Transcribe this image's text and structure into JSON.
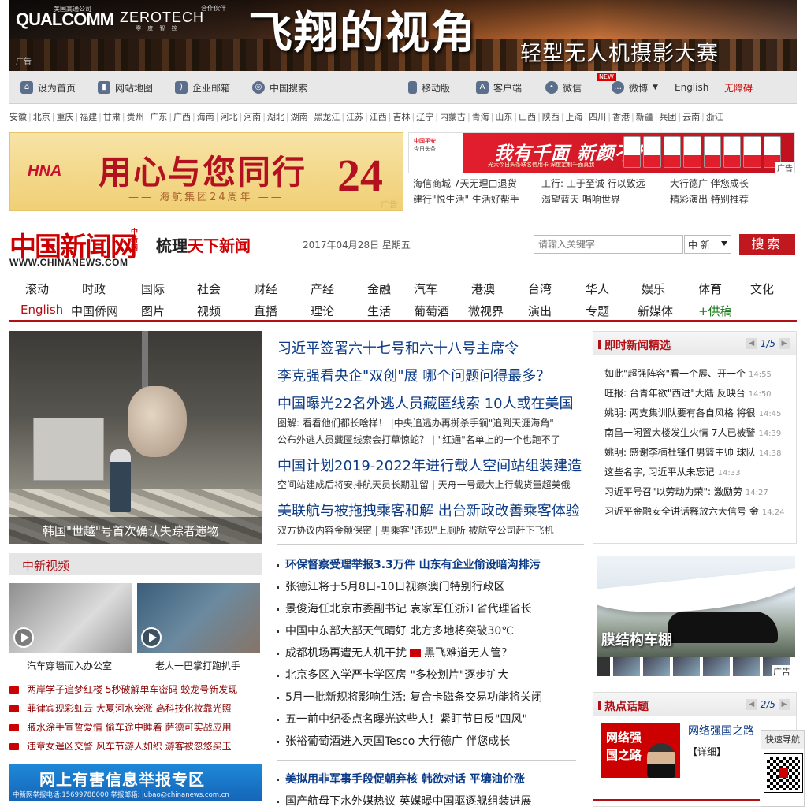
{
  "banner": {
    "qualcomm": "QUALCOMM",
    "qualcomm_cn": "美国高通公司",
    "zerotech": "ZEROTECH",
    "zerotech_sub": "零 度 智 控",
    "partner": "合作伙伴",
    "ad": "广告",
    "title": "飞翔的视角",
    "subtitle": "轻型无人机摄影大赛"
  },
  "toolbar": {
    "home": "设为首页",
    "sitemap": "网站地图",
    "mail": "企业邮箱",
    "search": "中国搜索",
    "mobile": "移动版",
    "client": "客户端",
    "wechat": "微信",
    "new": "NEW",
    "weibo": "微博",
    "english": "English",
    "accessible": "无障碍",
    "icons": {
      "home": "home-icon",
      "sitemap": "book-icon",
      "mail": "rss-icon",
      "search": "globe-icon",
      "mobile": "phone-icon",
      "client": "app-icon",
      "wechat": "wechat-icon",
      "weibo": "weibo-icon"
    }
  },
  "provinces": [
    "安徽",
    "北京",
    "重庆",
    "福建",
    "甘肃",
    "贵州",
    "广东",
    "广西",
    "海南",
    "河北",
    "河南",
    "湖北",
    "湖南",
    "黑龙江",
    "江苏",
    "江西",
    "吉林",
    "辽宁",
    "内蒙古",
    "青海",
    "山东",
    "山西",
    "陕西",
    "上海",
    "四川",
    "香港",
    "新疆",
    "兵团",
    "云南",
    "浙江"
  ],
  "ads": {
    "hna_logo": "HNA",
    "hna_title": "用心与您同行",
    "hna_num": "24",
    "hna_sub": "—— 海航集团24周年 ——",
    "hna_ad": "广告",
    "jd_logo1": "中国平安",
    "jd_logo2": "今日头条",
    "jd_title": "我有千面 新颜不凡",
    "jd_sub": "光大今日头条联名信用卡 深度定制千面真我",
    "jd_ad": "广告",
    "links": [
      "海信商城 7天无理由退货",
      "工行: 工于至诚 行以致远",
      "大行德广 伴您成长",
      "建行\"悦生活\" 生活好帮手",
      "渴望蓝天 唱响世界",
      "精彩演出 特别推荐"
    ]
  },
  "masthead": {
    "logo": "中国新闻网",
    "logo_side": "中新网",
    "logo_en": "WWW.CHINANEWS.COM",
    "slogan_a": "梳理",
    "slogan_b": "天下新闻",
    "date": "2017年04月28日 星期五",
    "search_placeholder": "请输入关键字",
    "search_scope": "中 新",
    "search_button": "搜索"
  },
  "nav": {
    "row1": [
      "滚动",
      "时政",
      "国际",
      "社会",
      "财经",
      "产经",
      "金融",
      "汽车",
      "港澳",
      "台湾",
      "华人",
      "娱乐",
      "体育",
      "文化"
    ],
    "row2": [
      "English",
      "中国侨网",
      "图片",
      "视频",
      "直播",
      "理论",
      "生活",
      "葡萄酒",
      "微视界",
      "演出",
      "专题",
      "新媒体",
      "+供稿"
    ]
  },
  "hero": {
    "caption": "韩国\"世越\"号首次确认失踪者遗物"
  },
  "headlines": {
    "h1": "习近平签署六十七号和六十八号主席令",
    "h2": "李克强看央企\"双创\"展 哪个问题问得最多？",
    "h3": "中国曝光22名外逃人员藏匿线索 10人或在美国",
    "s3a": "图解: 看看他们都长啥样！ |中央追逃办再掷杀手锏\"追到天涯海角\"",
    "s3b": "公布外逃人员藏匿线索会打草惊蛇？ | \"红通\"名单上的一个也跑不了",
    "h4": "中国计划2019-2022年进行载人空间站组装建造",
    "s4": "空间站建成后将安排航天员长期驻留 | 天舟一号最大上行载货量超美俄",
    "h5": "美联航与被拖拽乘客和解 出台新政改善乘客体验",
    "s5": "双方协议内容金额保密 | 男乘客\"违规\"上厕所 被航空公司赶下飞机"
  },
  "instant": {
    "title": "即时新闻精选",
    "page": "1/5",
    "items": [
      {
        "text": "如此\"超强阵容\"看一个展、开一个",
        "time": "14:55"
      },
      {
        "text": "旺报: 台青年欲\"西进\"大陆 反映台",
        "time": "14:50"
      },
      {
        "text": "姚明: 两支集训队要有各自风格 将很",
        "time": "14:45"
      },
      {
        "text": "南昌一闲置大楼发生火情 7人已被警",
        "time": "14:39"
      },
      {
        "text": "姚明: 感谢李楠杜锋任男篮主帅 球队",
        "time": "14:38"
      },
      {
        "text": "这些名字, 习近平从未忘记",
        "time": "14:33"
      },
      {
        "text": "习近平号召\"以劳动为荣\": 激励劳",
        "time": "14:27"
      },
      {
        "text": "习近平金融安全讲话释放六大信号 金",
        "time": "14:24"
      }
    ]
  },
  "video": {
    "title": "中新视频",
    "cap1": "汽车穿墙而入办公室",
    "cap2": "老人一巴掌打跑扒手",
    "list": [
      "两岸学子追梦红楼 5秒破解单车密码 蛟龙号新发现",
      "菲律宾现彩虹云 大夏河水突涨 高科技化妆靠光照",
      "腋水涂手宣誓爱情 偷车途中睡着 萨德可实战应用",
      "违章女逞凶交警 风车节游人如织 游客被忽悠买玉"
    ]
  },
  "report": {
    "title": "网上有害信息举报专区",
    "info": "中新网举报电话:15699788000  举报邮箱: jubao@chinanews.com.cn"
  },
  "midlist": [
    {
      "text": "环保督察受理举报3.3万件 山东有企业偷设暗沟排污",
      "bold": true
    },
    {
      "text": "张德江将于5月8日-10日视察澳门特别行政区",
      "bold": false
    },
    {
      "text": "景俊海任北京市委副书记 袁家军任浙江省代理省长",
      "bold": false
    },
    {
      "text": "中国中东部大部天气晴好 北方多地将突破30℃",
      "bold": false
    },
    {
      "text": "成都机场再遭无人机干扰",
      "icon": true,
      "text2": "黑飞难道无人管？",
      "bold": false
    },
    {
      "text": "北京多区入学严卡学区房 \"多校划片\"逐步扩大",
      "bold": false
    },
    {
      "text": "5月一批新规将影响生活: 复合卡磁条交易功能将关闭",
      "bold": false
    },
    {
      "text": "五一前中纪委点名曝光这些人！紧盯节日反\"四风\"",
      "bold": false
    },
    {
      "text": "张裕葡萄酒进入英国Tesco 大行德广 伴您成长",
      "bold": false
    },
    {
      "text": "美拟用非军事手段促朝弃核 韩欲对话 平壤油价涨",
      "bold": true
    },
    {
      "text": "国产航母下水外媒热议 英媒曝中国驱逐舰组装进展",
      "bold": false
    }
  ],
  "carport": {
    "text": "膜结构车棚",
    "ad": "广告"
  },
  "hot": {
    "title": "热点话题",
    "page": "2/5",
    "img_text": "网络强国之路",
    "topic": "网络强国之路",
    "more": "【详细】"
  },
  "quick": {
    "label": "快速导航"
  }
}
